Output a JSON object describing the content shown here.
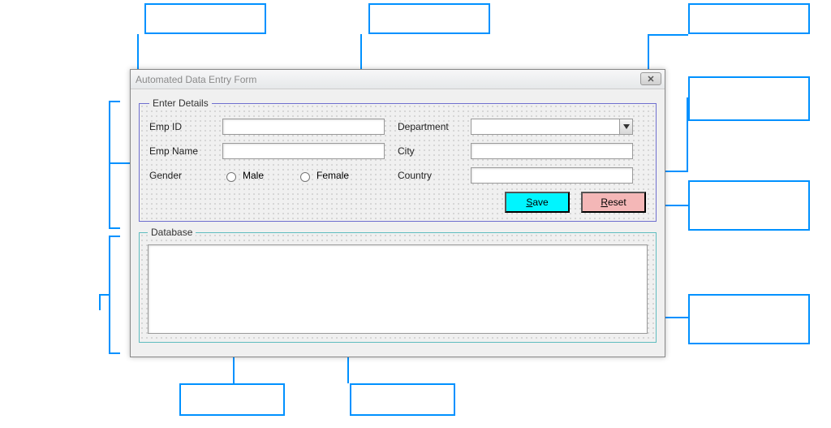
{
  "window": {
    "title": "Automated Data Entry Form"
  },
  "frames": {
    "enter_details": "Enter Details",
    "database": "Database"
  },
  "labels": {
    "emp_id": "Emp ID",
    "emp_name": "Emp Name",
    "gender": "Gender",
    "department": "Department",
    "city": "City",
    "country": "Country"
  },
  "gender": {
    "male": "Male",
    "female": "Female"
  },
  "buttons": {
    "save": "Save",
    "reset": "Reset"
  },
  "fields": {
    "emp_id": "",
    "emp_name": "",
    "department": "",
    "city": "",
    "country": ""
  },
  "callouts": {
    "top1": "",
    "top2": "",
    "top3": "",
    "right1": "",
    "right2": "",
    "right3": "",
    "bottom1": "",
    "bottom2": ""
  }
}
